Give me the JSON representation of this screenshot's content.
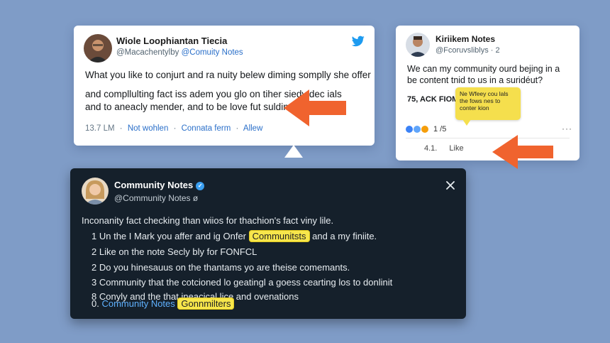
{
  "tweet_card": {
    "name": "Wiole Loophiantan Tiecia",
    "handle_prefix": "@Macachentylby",
    "handle_link": "@Comuity Notes",
    "line1": "What you like to conjurt and ra nuity belew diming somplly she offer",
    "line2": "and compllulting fact iss adem you glo on tiher siedy dec ials",
    "line3": "and to aneacly mender, and to be love fut sulding.",
    "meta_count": "13.7 LM",
    "meta_link1": "Not wohlen",
    "meta_link2": "Connata ferm",
    "meta_link3": "Allew",
    "meta_sep": "·",
    "bird_icon": "twitter-bird-icon"
  },
  "notes_card": {
    "name": "Kiriikem Notes",
    "handle": "@Fcoruvsliblys · 2",
    "line1": "We can my community ourd bejing in a",
    "line2": "be content tnid to us in a suridéut?",
    "line3": "75, ACK FIOM",
    "sticky_note": "Ne Wfeey cou lals the fows nes to conter kion",
    "reaction_count": "1 /5",
    "more": "···",
    "footer_count": "4.1.",
    "footer_like": "Like"
  },
  "community_notes": {
    "name": "Community Notes",
    "verified_icon": "verified-badge-icon",
    "handle": "@Community Notes",
    "handle_suffix": "ø",
    "intro": "Inconanity fact checking than wiios for thachion's fact viny lile.",
    "items": [
      {
        "num": "1",
        "before": "Un the I Mark you affer and ig Onfer",
        "highlight": "Communitsts",
        "after": "and a my finiite."
      },
      {
        "num": "2",
        "text": "Like on the note Secly bly for FONFCL"
      },
      {
        "num": "2",
        "text": "Do you hinesauus on the thantams yo are theise comemants."
      },
      {
        "num": "3",
        "text": "Community that the cotcioned lo geatingl a goess cearting los to donlinit"
      },
      {
        "num": "8",
        "text": "Conyly and the that ineacical lice and ovenations"
      },
      {
        "num": "0.",
        "link": "Community Notes",
        "highlight": "Gonnmilters"
      }
    ],
    "close_icon": "close-icon"
  },
  "colors": {
    "background": "#7f9cc7",
    "dark_card": "#15202b",
    "arrow": "#f0632e",
    "highlight": "#f7e64b",
    "link_blue": "#2a6fc9"
  }
}
